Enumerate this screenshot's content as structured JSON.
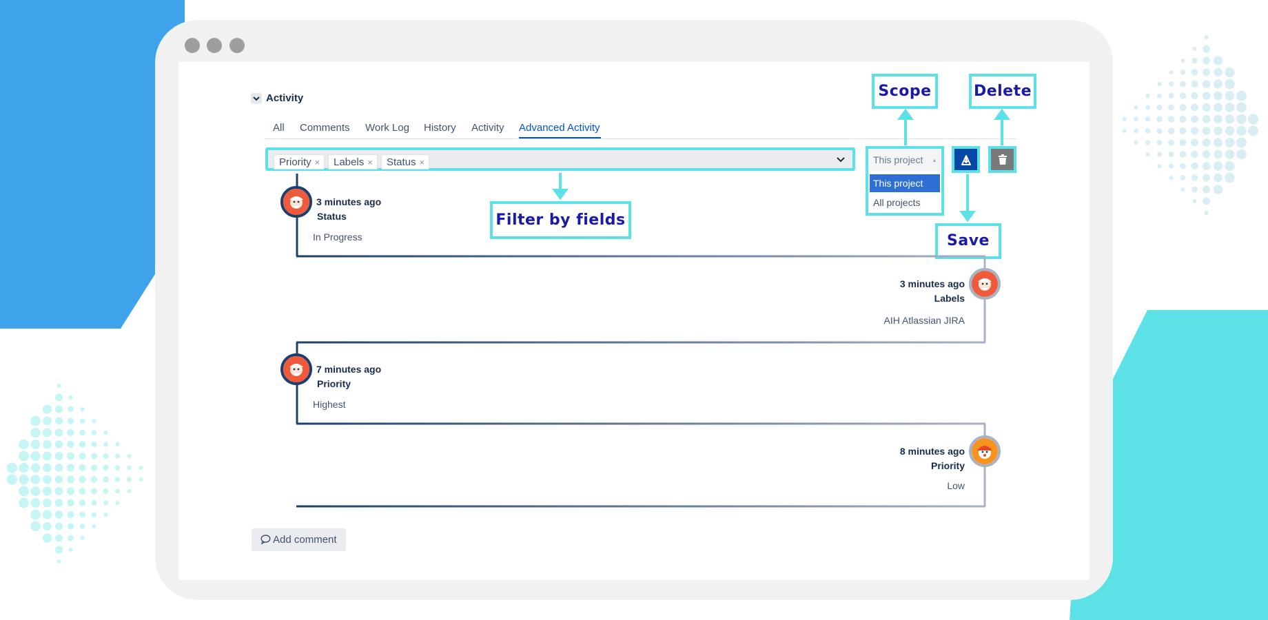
{
  "activity": {
    "title": "Activity",
    "tabs": [
      {
        "label": "All",
        "active": false
      },
      {
        "label": "Comments",
        "active": false
      },
      {
        "label": "Work Log",
        "active": false
      },
      {
        "label": "History",
        "active": false
      },
      {
        "label": "Activity",
        "active": false
      },
      {
        "label": "Advanced Activity",
        "active": true
      }
    ]
  },
  "filter": {
    "chips": [
      "Priority",
      "Labels",
      "Status"
    ],
    "remove_glyph": "×"
  },
  "scope": {
    "current": "This project",
    "options": [
      "This project",
      "All projects"
    ],
    "selected_index": 0
  },
  "actions": {
    "save_icon": "save-icon",
    "delete_icon": "trash-icon"
  },
  "callouts": {
    "scope": "Scope",
    "delete": "Delete",
    "filter": "Filter by fields",
    "save": "Save"
  },
  "entries": [
    {
      "time": "3 minutes ago",
      "field": "Status",
      "value": "In Progress",
      "side": "left"
    },
    {
      "time": "3 minutes ago",
      "field": "Labels",
      "value": "AIH Atlassian JIRA",
      "side": "right"
    },
    {
      "time": "7 minutes ago",
      "field": "Priority",
      "value": "Highest",
      "side": "left"
    },
    {
      "time": "8 minutes ago",
      "field": "Priority",
      "value": "Low",
      "side": "right"
    }
  ],
  "add_comment_label": "Add comment",
  "colors": {
    "accent_cyan": "#5ce1e6",
    "brand_blue": "#3fa3ec",
    "callout_text": "#1a1aa6",
    "link_blue": "#0052cc"
  }
}
